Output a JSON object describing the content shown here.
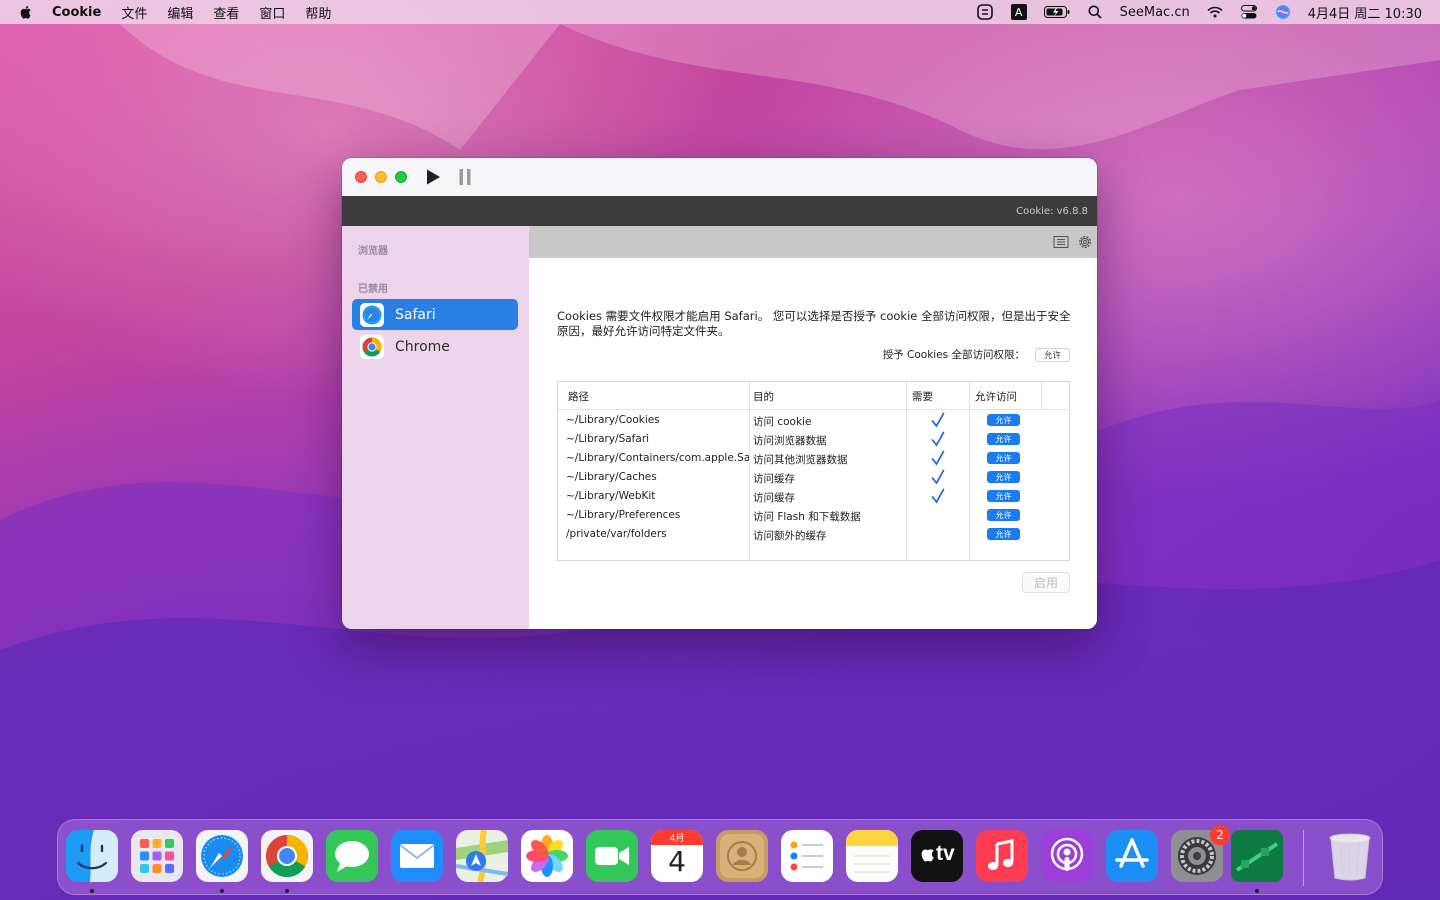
{
  "menubar": {
    "app_name": "Cookie",
    "menus": [
      "文件",
      "编辑",
      "查看",
      "窗口",
      "帮助"
    ],
    "site": "SeeMac.cn",
    "datetime": "4月4日 周二  10:30",
    "input_method": "A"
  },
  "window": {
    "version": "Cookie: v6.8.8",
    "sidebar": {
      "header_browsers": "浏览器",
      "header_disabled": "已禁用",
      "items": [
        {
          "label": "Safari",
          "icon": "safari-icon",
          "selected": true
        },
        {
          "label": "Chrome",
          "icon": "chrome-icon",
          "selected": false
        }
      ]
    },
    "description": "Cookies 需要文件权限才能启用 Safari。 您可以选择是否授予 cookie 全部访问权限，但是出于安全原因，最好允许访问特定文件夹。",
    "grant_label": "授予 Cookies 全部访问权限：",
    "grant_button": "允许",
    "table": {
      "columns": [
        "路径",
        "目的",
        "需要",
        "允许访问"
      ],
      "rows": [
        {
          "path": "~/Library/Cookies",
          "purpose": "访问 cookie",
          "required": true,
          "action": "允许"
        },
        {
          "path": "~/Library/Safari",
          "purpose": "访问浏览器数据",
          "required": true,
          "action": "允许"
        },
        {
          "path": "~/Library/Containers/com.apple.Sa",
          "purpose": "访问其他浏览器数据",
          "required": true,
          "action": "允许"
        },
        {
          "path": "~/Library/Caches",
          "purpose": "访问缓存",
          "required": true,
          "action": "允许"
        },
        {
          "path": "~/Library/WebKit",
          "purpose": "访问缓存",
          "required": true,
          "action": "允许"
        },
        {
          "path": "~/Library/Preferences",
          "purpose": "访问 Flash 和下载数据",
          "required": false,
          "action": "允许"
        },
        {
          "path": "/private/var/folders",
          "purpose": "访问额外的缓存",
          "required": false,
          "action": "允许"
        }
      ]
    },
    "enable_button": "启用"
  },
  "dock": {
    "calendar_month": "4月",
    "calendar_day": "4",
    "tv_label": "tv",
    "settings_badge": "2",
    "apps": [
      "finder",
      "launchpad",
      "safari",
      "chrome",
      "messages",
      "mail",
      "maps",
      "photos",
      "facetime",
      "calendar",
      "contacts",
      "reminders",
      "notes",
      "apple-tv",
      "music",
      "podcasts",
      "app-store",
      "system-preferences",
      "green-app",
      "trash"
    ]
  },
  "colors": {
    "accent_blue": "#2a7fe4",
    "sidebar_bg": "#ecd4ea",
    "version_bar": "#3c3c3c"
  }
}
